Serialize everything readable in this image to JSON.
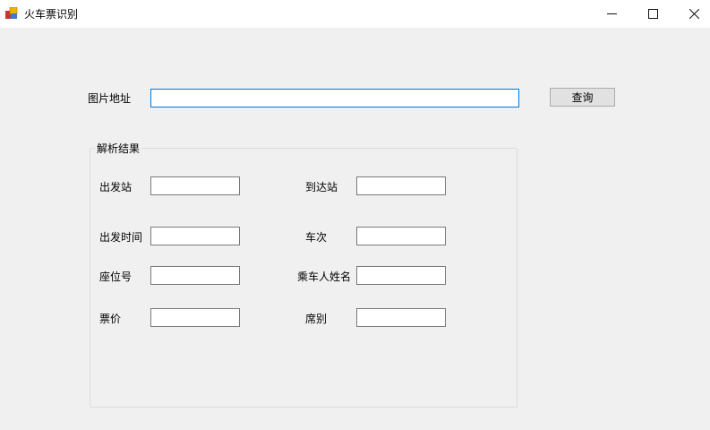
{
  "window": {
    "title": "火车票识别",
    "minimize_icon": "minimize-icon",
    "maximize_icon": "maximize-icon",
    "close_icon": "close-icon"
  },
  "query": {
    "label": "图片地址",
    "value": "",
    "button": "查询"
  },
  "result": {
    "group_title": "解析结果",
    "fields": {
      "departure": {
        "label": "出发站",
        "value": ""
      },
      "arrival": {
        "label": "到达站",
        "value": ""
      },
      "departure_time": {
        "label": "出发时间",
        "value": ""
      },
      "train_no": {
        "label": "车次",
        "value": ""
      },
      "seat_no": {
        "label": "座位号",
        "value": ""
      },
      "passenger": {
        "label": "乘车人姓名",
        "value": ""
      },
      "price": {
        "label": "票价",
        "value": ""
      },
      "seat_class": {
        "label": "席别",
        "value": ""
      }
    }
  }
}
